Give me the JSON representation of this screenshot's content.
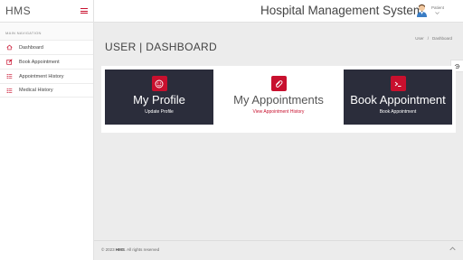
{
  "brand": {
    "name": "HMS"
  },
  "header": {
    "title": "Hospital Management System",
    "user_label": "Patient"
  },
  "sidebar": {
    "caption": "MAIN NAVIGATION",
    "items": [
      {
        "label": "Dashboard",
        "icon": "home-icon"
      },
      {
        "label": "Book Appointment",
        "icon": "edit-icon"
      },
      {
        "label": "Appointment History",
        "icon": "list-icon"
      },
      {
        "label": "Medical History",
        "icon": "list-icon"
      }
    ]
  },
  "page": {
    "title": "USER | DASHBOARD",
    "breadcrumb": [
      "User",
      "/",
      "Dashboard"
    ]
  },
  "cards": [
    {
      "title": "My Profile",
      "link": "Update Profile",
      "icon": "smiley-icon"
    },
    {
      "title": "My Appointments",
      "link": "View Appointment History",
      "icon": "paperclip-icon"
    },
    {
      "title": "Book Appointment",
      "link": "Book Appointment",
      "icon": "terminal-icon"
    }
  ],
  "footer": {
    "prefix": "© 2023 ",
    "brand": "HMS",
    "suffix": ". All rights reserved"
  },
  "colors": {
    "accent": "#c8102e",
    "dark_card": "#2b2d3b",
    "background": "#ececec"
  }
}
